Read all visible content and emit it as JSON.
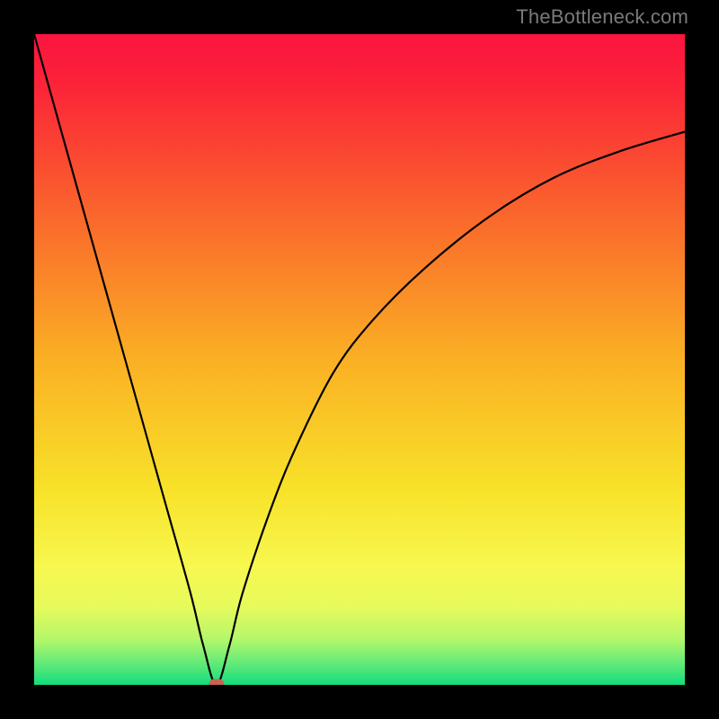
{
  "watermark": {
    "text": "TheBottleneck.com"
  },
  "colors": {
    "frame": "#000000",
    "curve": "#000000",
    "marker": "#c86450",
    "gradient_stops": [
      {
        "offset": 0.0,
        "color": "#fb1440"
      },
      {
        "offset": 0.08,
        "color": "#fb2438"
      },
      {
        "offset": 0.3,
        "color": "#fa6e2b"
      },
      {
        "offset": 0.5,
        "color": "#fab024"
      },
      {
        "offset": 0.7,
        "color": "#f8e229"
      },
      {
        "offset": 0.82,
        "color": "#f7f850"
      },
      {
        "offset": 0.88,
        "color": "#e7fa5c"
      },
      {
        "offset": 0.93,
        "color": "#b4f76a"
      },
      {
        "offset": 0.97,
        "color": "#5be979"
      },
      {
        "offset": 1.0,
        "color": "#12dd7e"
      }
    ]
  },
  "chart_data": {
    "type": "line",
    "title": "",
    "xlabel": "",
    "ylabel": "",
    "xlim": [
      0,
      100
    ],
    "ylim": [
      0,
      100
    ],
    "grid": false,
    "curve_description": "V-shaped bottleneck curve: steep near-linear descent from top-left down to a minimum near x≈28, then asymptotic rise toward upper right.",
    "minimum": {
      "x": 28,
      "y": 0
    },
    "series": [
      {
        "name": "bottleneck-curve",
        "x": [
          0,
          4,
          8,
          12,
          16,
          20,
          24,
          26,
          28,
          30,
          32,
          36,
          40,
          46,
          52,
          60,
          70,
          80,
          90,
          100
        ],
        "values": [
          100,
          85.7,
          71.4,
          57.1,
          42.8,
          28.5,
          14.2,
          6,
          0,
          6,
          14,
          26,
          36,
          48,
          56,
          64,
          72,
          78,
          82,
          85
        ]
      }
    ],
    "marker": {
      "x": 28,
      "y": 0,
      "name": "optimal-point"
    }
  }
}
